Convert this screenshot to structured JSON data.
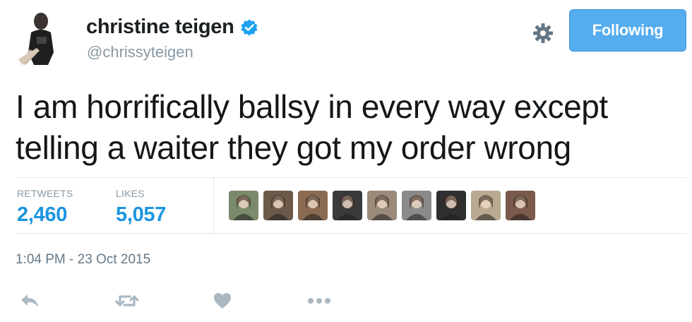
{
  "header": {
    "display_name": "christine teigen",
    "handle": "@chrissyteigen",
    "follow_label": "Following"
  },
  "tweet": {
    "lines": [
      "I am horrifically ballsy in every way except",
      "telling a waiter they got my order wrong"
    ]
  },
  "stats": {
    "retweets_label": "RETWEETS",
    "retweets_value": "2,460",
    "likes_label": "LIKES",
    "likes_value": "5,057"
  },
  "timestamp": "1:04 PM - 23 Oct 2015",
  "likers": [
    {
      "color": "#7a8a6a"
    },
    {
      "color": "#6b5a4a"
    },
    {
      "color": "#8a6a50"
    },
    {
      "color": "#3a3a3a"
    },
    {
      "color": "#9a8a7a"
    },
    {
      "color": "#8a8a8a"
    },
    {
      "color": "#2f2f2f"
    },
    {
      "color": "#b8a990"
    },
    {
      "color": "#7a5a4a"
    }
  ],
  "colors": {
    "accent": "#1b95e0",
    "follow_bg": "#55acee",
    "verified": "#1da1f2",
    "muted": "#8899a6",
    "action_icon": "#aab8c2"
  },
  "icons": [
    "verified-badge-icon",
    "gear-icon",
    "reply-icon",
    "retweet-icon",
    "heart-icon",
    "more-icon"
  ]
}
